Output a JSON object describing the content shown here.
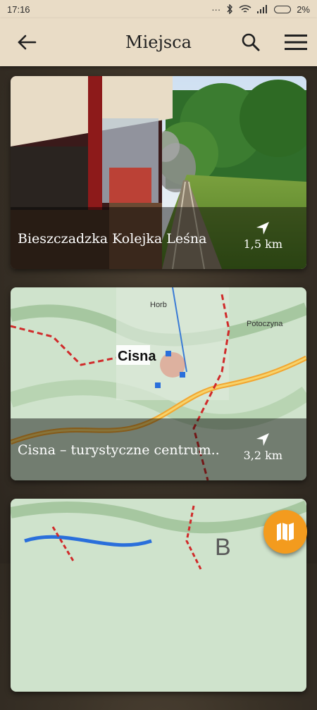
{
  "status_bar": {
    "time": "17:16",
    "battery": "2%"
  },
  "app_bar": {
    "title": "Miejsca"
  },
  "icons": {
    "back": "arrow-left-icon",
    "search": "search-icon",
    "menu": "hamburger-icon",
    "fab": "map-icon",
    "distance": "navigation-arrow-icon"
  },
  "places": [
    {
      "title": "Bieszczadzka Kolejka Leśna",
      "distance": "1,5 km"
    },
    {
      "title": "Cisna – turystyczne centrum..",
      "distance": "3,2 km"
    },
    {
      "title": "",
      "distance": ""
    }
  ],
  "map_labels": {
    "card2_town": "Cisna",
    "card2_peak": "Horb",
    "card2_extra": "Potoczyna",
    "card3_letter": "B"
  },
  "colors": {
    "accent": "#f39b1e",
    "bar": "#e9dcc6"
  }
}
